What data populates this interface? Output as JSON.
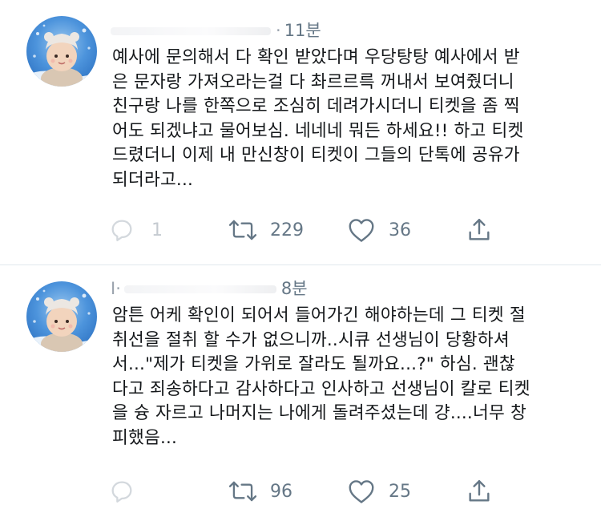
{
  "tweets": [
    {
      "name_mark": "·",
      "time": "11분",
      "text": "예사에 문의해서 다 확인 받았다며 우당탕탕 예사에서 받\n은 문자랑 가져오라는걸 다 촤르르륵 꺼내서 보여줬더니\n친구랑 나를 한쪽으로 조심히 데려가시더니 티켓을 좀 찍\n어도 되겠냐고 물어보심. 네네네 뭐든 하세요!! 하고 티켓\n드렸더니 이제 내 만신창이 티켓이 그들의 단톡에 공유가\n되더라고...",
      "reply_count": "1",
      "retweet_count": "229",
      "like_count": "36"
    },
    {
      "name_mark": "I·",
      "time": "8분",
      "text": "암튼 어케 확인이 되어서 들어가긴 해야하는데 그 티켓 절\n취선을 절취 할 수가 없으니까..시큐 선생님이 당황하셔\n서...\"제가 티켓을 가위로 잘라도 될까요...?\" 하심. 괜찮\n다고 죄송하다고 감사하다고 인사하고 선생님이 칼로 티켓\n을 슝 자르고 나머지는 나에게 돌려주셨는데 걍....너무 창\n피했음...",
      "reply_count": "",
      "retweet_count": "96",
      "like_count": "25"
    }
  ],
  "icons": {
    "reply": "reply-bubble-icon",
    "retweet": "retweet-icon",
    "like": "heart-icon",
    "share": "share-icon"
  },
  "colors": {
    "text": "#14171a",
    "muted": "#657786",
    "avatar_bg": "#4a8fd8"
  }
}
